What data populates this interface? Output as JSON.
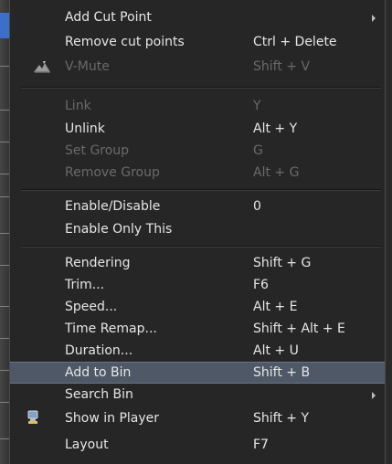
{
  "menu": {
    "items": [
      {
        "label": "Add Cut Point",
        "shortcut": "",
        "submenu": true
      },
      {
        "label": "Remove cut points",
        "shortcut": "Ctrl + Delete"
      },
      {
        "label": "V-Mute",
        "shortcut": "Shift + V",
        "disabled": true,
        "icon": "mute-icon"
      },
      {
        "label": "Link",
        "shortcut": "Y",
        "disabled": true
      },
      {
        "label": "Unlink",
        "shortcut": "Alt + Y"
      },
      {
        "label": "Set Group",
        "shortcut": "G",
        "disabled": true
      },
      {
        "label": "Remove Group",
        "shortcut": "Alt + G",
        "disabled": true
      },
      {
        "label": "Enable/Disable",
        "shortcut": "0"
      },
      {
        "label": "Enable Only This",
        "shortcut": ""
      },
      {
        "label": "Rendering",
        "shortcut": "Shift + G"
      },
      {
        "label": "Trim...",
        "shortcut": "F6"
      },
      {
        "label": "Speed...",
        "shortcut": "Alt + E"
      },
      {
        "label": "Time Remap...",
        "shortcut": "Shift + Alt + E"
      },
      {
        "label": "Duration...",
        "shortcut": "Alt + U"
      },
      {
        "label": "Add to Bin",
        "shortcut": "Shift + B",
        "highlighted": true
      },
      {
        "label": "Search Bin",
        "shortcut": "",
        "submenu": true
      },
      {
        "label": "Show in Player",
        "shortcut": "Shift + Y",
        "icon": "player-icon"
      },
      {
        "label": "Layout",
        "shortcut": "F7"
      }
    ]
  },
  "colors": {
    "menu_bg": "#262626",
    "text": "#e6e6e6",
    "disabled_text": "#6a6a6a",
    "highlight_bg": "#4e5866",
    "left_strip_accent": "#3c6fc9"
  }
}
